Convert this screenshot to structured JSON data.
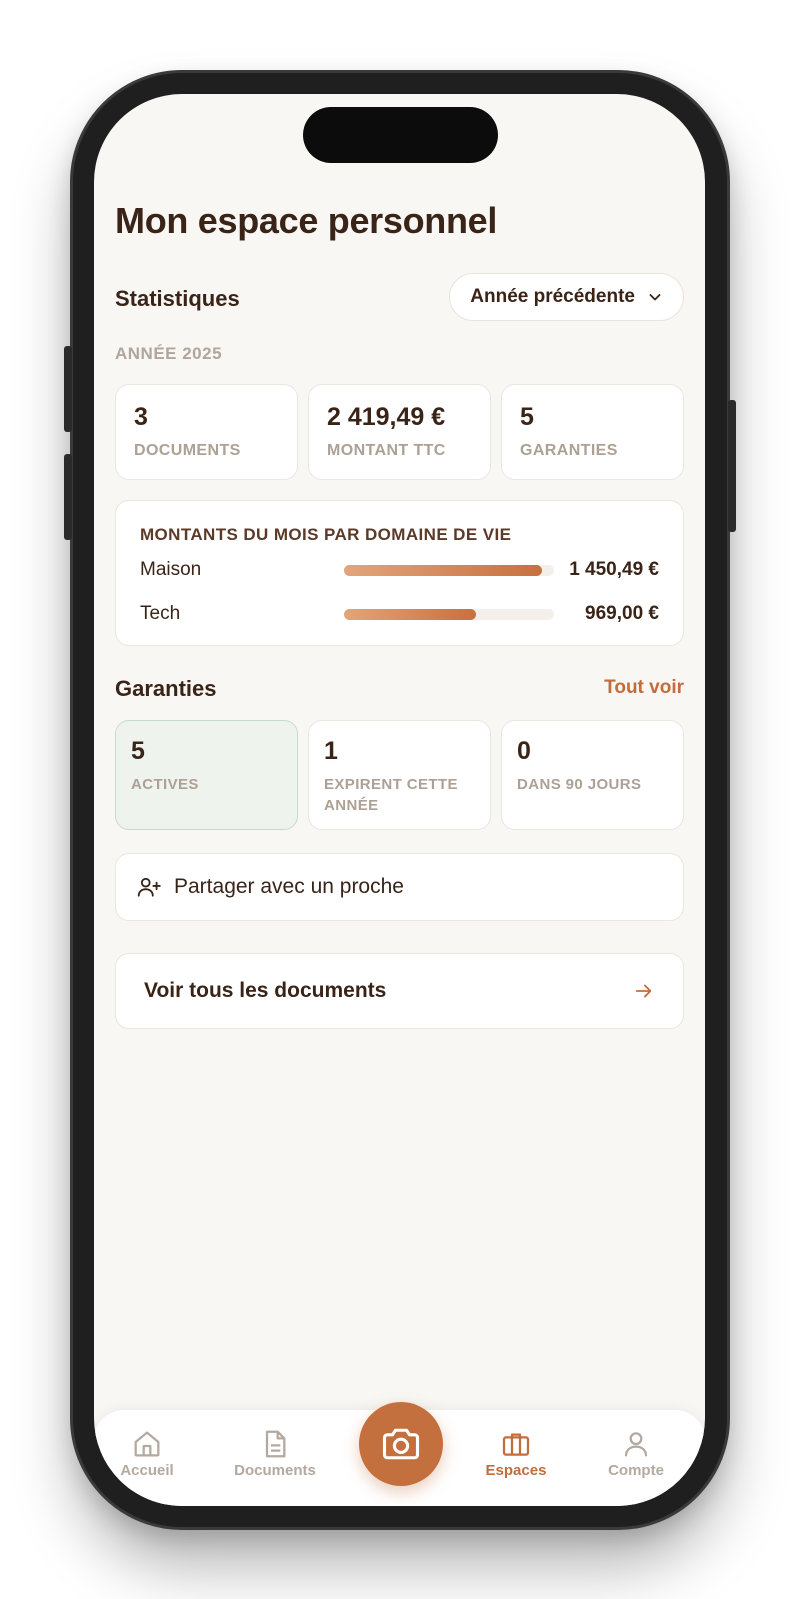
{
  "page": {
    "title": "Mon espace personnel"
  },
  "stats": {
    "title": "Statistiques",
    "period_select": "Année précédente",
    "year_caption": "ANNÉE 2025",
    "cards": [
      {
        "value": "3",
        "label": "DOCUMENTS"
      },
      {
        "value": "2 419,49 €",
        "label": "MONTANT TTC"
      },
      {
        "value": "5",
        "label": "GARANTIES"
      }
    ]
  },
  "breakdown": {
    "title": "MONTANTS DU MOIS PAR DOMAINE DE VIE",
    "rows": [
      {
        "label": "Maison",
        "amount": "1 450,49 €",
        "value": 1450.49
      },
      {
        "label": "Tech",
        "amount": "969,00 €",
        "value": 969.0
      }
    ]
  },
  "guarantees": {
    "title": "Garanties",
    "see_all": "Tout voir",
    "cards": [
      {
        "value": "5",
        "label": "ACTIVES"
      },
      {
        "value": "1",
        "label": "EXPIRENT CETTE ANNÉE"
      },
      {
        "value": "0",
        "label": "DANS 90 JOURS"
      }
    ]
  },
  "share": {
    "label": "Partager avec un proche"
  },
  "all_docs": {
    "label": "Voir tous les documents"
  },
  "tabbar": {
    "tabs": [
      {
        "label": "Accueil",
        "icon": "home-icon"
      },
      {
        "label": "Documents",
        "icon": "document-icon"
      },
      {
        "label": "Espaces",
        "icon": "briefcase-icon",
        "selected": true
      },
      {
        "label": "Compte",
        "icon": "user-icon"
      }
    ],
    "camera_icon": "camera-icon"
  },
  "colors": {
    "accent": "#c26d3c",
    "text": "#3a2418",
    "muted": "#ada095",
    "background": "#f8f7f4",
    "active_card": "#eef3ee"
  }
}
